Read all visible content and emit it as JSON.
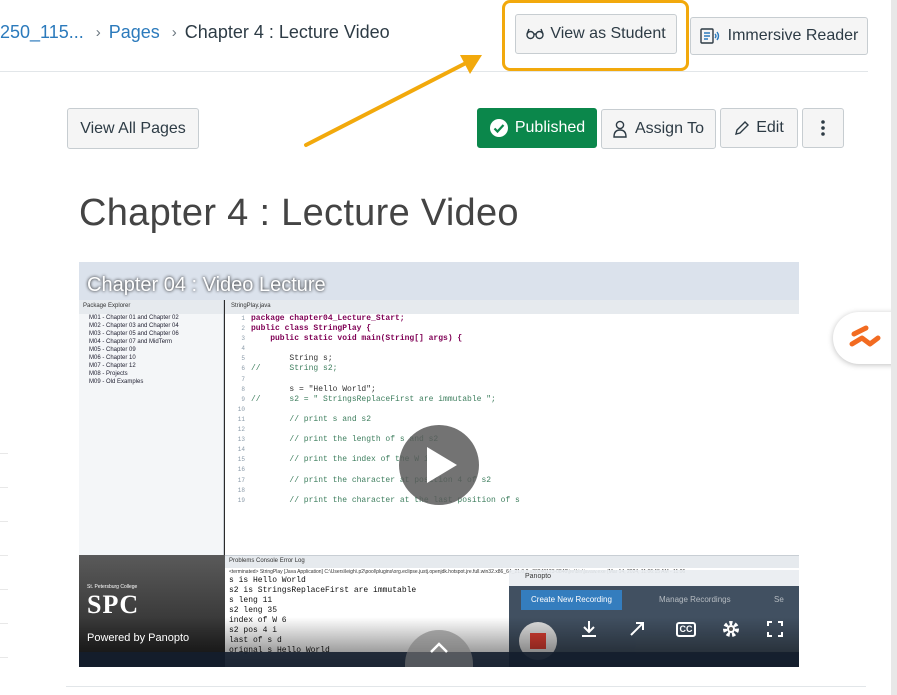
{
  "breadcrumb": {
    "course": "250_115...",
    "section": "Pages",
    "current": "Chapter 4 : Lecture Video"
  },
  "header_buttons": {
    "view_as_student": "View as Student",
    "immersive_reader": "Immersive Reader"
  },
  "toolbar": {
    "view_all_pages": "View All Pages",
    "published": "Published",
    "assign_to": "Assign To",
    "edit": "Edit"
  },
  "page": {
    "title": "Chapter 4 : Lecture Video"
  },
  "video": {
    "title": "Chapter 04 : Video Lecture",
    "powered_by": "Powered by Panopto",
    "logo_text": "SPC",
    "logo_caption": "St. Petersburg College",
    "cc_label": "CC",
    "ide": {
      "package_panel_title": "Package Explorer",
      "editor_tab": "StringPlay.java",
      "packages": [
        "M01 - Chapter 01 and Chapter 02",
        "M02 - Chapter 03 and Chapter 04",
        "M03 - Chapter 05 and Chapter 06",
        "M04 - Chapter 07 and MidTerm",
        "M05 - Chapter 09",
        "M06 - Chapter 10",
        "M07 - Chapter 12",
        "M08 - Projects",
        "M09 - Old Examples"
      ],
      "code": [
        {
          "n": "1",
          "t": "package chapter04_Lecture_Start;"
        },
        {
          "n": "2",
          "t": "public class StringPlay {"
        },
        {
          "n": "3",
          "t": "    public static void main(String[] args) {"
        },
        {
          "n": "4",
          "t": ""
        },
        {
          "n": "5",
          "t": "        String s;"
        },
        {
          "n": "6",
          "t": "//      String s2;"
        },
        {
          "n": "7",
          "t": ""
        },
        {
          "n": "8",
          "t": "        s = \"Hello World\";"
        },
        {
          "n": "9",
          "t": "//      s2 = \" StringsReplaceFirst are immutable \";"
        },
        {
          "n": "10",
          "t": ""
        },
        {
          "n": "11",
          "t": "        // print s and s2"
        },
        {
          "n": "12",
          "t": ""
        },
        {
          "n": "13",
          "t": "        // print the length of s and s2"
        },
        {
          "n": "14",
          "t": ""
        },
        {
          "n": "15",
          "t": "        // print the index of the W in"
        },
        {
          "n": "16",
          "t": ""
        },
        {
          "n": "17",
          "t": "        // print the character at position 4 of s2"
        },
        {
          "n": "18",
          "t": ""
        },
        {
          "n": "19",
          "t": "        // print the character at the last position of s"
        }
      ],
      "console_tabs": "Problems   Console   Error Log",
      "console_path": "<terminated> StringPlay [Java Application] C:\\Users\\leigh\\.p2\\pool\\plugins\\org.eclipse.justj.openjdk.hotspot.jre.full.win32.x86_64_21.0.2.v20240123-0840\\jre\\bin\\javaw.exe (Mar 14, 2024, 11:06:15 AM - 11:06",
      "console_lines": [
        "s is Hello World",
        "s2 is  StringsReplaceFirst are immutable",
        "s leng 11",
        "s2 leng 35",
        "index of W 6",
        "s2 pos 4 i",
        "last of s d",
        "orignal s Hello World"
      ]
    },
    "panopto": {
      "header": "Panopto",
      "create_tab": "Create New Recording",
      "manage_tab": "Manage Recordings",
      "settings_tab": "Se"
    }
  },
  "colors": {
    "link": "#2b7abc",
    "published_bg": "#0b874b",
    "highlight": "#f2a90c"
  }
}
